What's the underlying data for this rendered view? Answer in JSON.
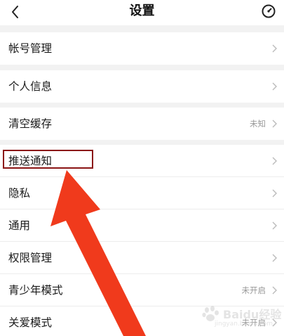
{
  "header": {
    "title": "设置",
    "back_icon": "chevron-left-icon",
    "right_icon": "scan-icon"
  },
  "groups": [
    {
      "items": [
        {
          "label": "帐号管理",
          "value": ""
        }
      ]
    },
    {
      "items": [
        {
          "label": "个人信息",
          "value": ""
        }
      ]
    },
    {
      "items": [
        {
          "label": "清空缓存",
          "value": "未知"
        }
      ]
    },
    {
      "items": [
        {
          "label": "推送通知",
          "value": ""
        },
        {
          "label": "隐私",
          "value": ""
        },
        {
          "label": "通用",
          "value": ""
        },
        {
          "label": "权限管理",
          "value": ""
        },
        {
          "label": "青少年模式",
          "value": "未开启"
        },
        {
          "label": "关爱模式",
          "value": "未开启"
        }
      ]
    }
  ],
  "annotation": {
    "highlight_color": "#8b1414",
    "arrow_color": "#f03a1c"
  },
  "watermark": {
    "text": "Baidu经验",
    "url": "jingyan.baidu.com"
  }
}
